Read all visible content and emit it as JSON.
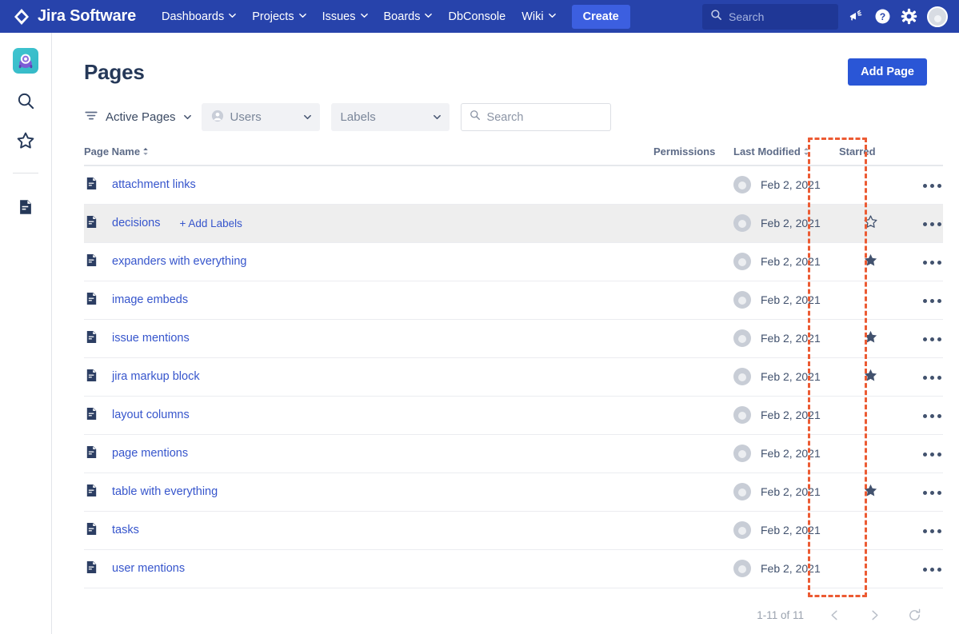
{
  "topnav": {
    "brand": "Jira Software",
    "brand_icon": "jira-diamond-logo",
    "items": [
      {
        "label": "Dashboards",
        "has_chevron": true
      },
      {
        "label": "Projects",
        "has_chevron": true
      },
      {
        "label": "Issues",
        "has_chevron": true
      },
      {
        "label": "Boards",
        "has_chevron": true
      },
      {
        "label": "DbConsole",
        "has_chevron": false
      },
      {
        "label": "Wiki",
        "has_chevron": true
      }
    ],
    "create_label": "Create",
    "search_placeholder": "Search",
    "search_value": "",
    "icons": [
      "megaphone-icon",
      "help-icon",
      "settings-gear-icon",
      "user-avatar"
    ],
    "background_color": "#2743ab",
    "create_color": "#3c5fe0"
  },
  "rail": {
    "items": [
      {
        "name": "app-logo",
        "label": "app"
      },
      {
        "name": "search-icon",
        "label": "search"
      },
      {
        "name": "star-icon",
        "label": "starred"
      },
      {
        "name": "pages-icon",
        "label": "pages"
      }
    ]
  },
  "header": {
    "title": "Pages",
    "add_page_label": "Add Page"
  },
  "filters": {
    "filter_icon": "filter-icon",
    "active_filter_label": "Active Pages",
    "users_placeholder": "Users",
    "labels_placeholder": "Labels",
    "search_placeholder": "Search",
    "search_value": ""
  },
  "table": {
    "columns": {
      "name": "Page Name",
      "permissions": "Permissions",
      "last_modified": "Last Modified",
      "starred": "Starred"
    },
    "sort_column": "Page Name",
    "sort_direction": "asc",
    "rows": [
      {
        "name": "attachment links",
        "date": "Feb 2, 2021",
        "starred": "none",
        "hovered": false,
        "add_labels": ""
      },
      {
        "name": "decisions",
        "date": "Feb 2, 2021",
        "starred": "outline",
        "hovered": true,
        "add_labels": "+ Add Labels"
      },
      {
        "name": "expanders with everything",
        "date": "Feb 2, 2021",
        "starred": "filled",
        "hovered": false,
        "add_labels": ""
      },
      {
        "name": "image embeds",
        "date": "Feb 2, 2021",
        "starred": "none",
        "hovered": false,
        "add_labels": ""
      },
      {
        "name": "issue mentions",
        "date": "Feb 2, 2021",
        "starred": "filled",
        "hovered": false,
        "add_labels": ""
      },
      {
        "name": "jira markup block",
        "date": "Feb 2, 2021",
        "starred": "filled",
        "hovered": false,
        "add_labels": ""
      },
      {
        "name": "layout columns",
        "date": "Feb 2, 2021",
        "starred": "none",
        "hovered": false,
        "add_labels": ""
      },
      {
        "name": "page mentions",
        "date": "Feb 2, 2021",
        "starred": "none",
        "hovered": false,
        "add_labels": ""
      },
      {
        "name": "table with everything",
        "date": "Feb 2, 2021",
        "starred": "filled",
        "hovered": false,
        "add_labels": ""
      },
      {
        "name": "tasks",
        "date": "Feb 2, 2021",
        "starred": "none",
        "hovered": false,
        "add_labels": ""
      },
      {
        "name": "user mentions",
        "date": "Feb 2, 2021",
        "starred": "none",
        "hovered": false,
        "add_labels": ""
      }
    ]
  },
  "annotation": {
    "target_column": "Starred",
    "color": "#ec5b33",
    "style": "dashed-rectangle"
  },
  "pagination": {
    "count_label": "1-11 of 11",
    "prev_icon": "chevron-left-icon",
    "next_icon": "chevron-right-icon",
    "refresh_icon": "refresh-icon"
  }
}
